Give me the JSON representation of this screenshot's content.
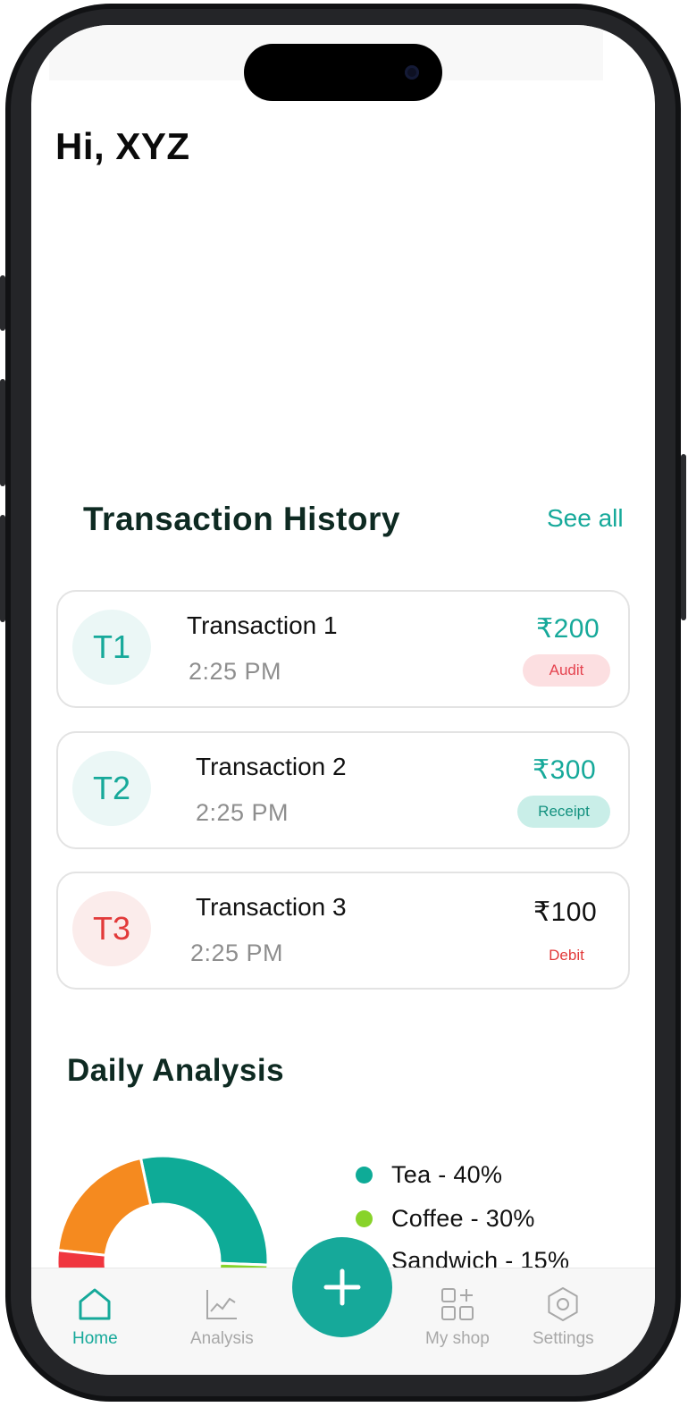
{
  "header": {
    "greeting": "Hi, XYZ"
  },
  "transactions_section": {
    "title": "Transaction History",
    "see_all_label": "See all",
    "items": [
      {
        "initials": "T1",
        "name": "Transaction 1",
        "time": "2:25 PM",
        "amount": "₹200",
        "tag": "Audit",
        "accent": "#16a99a",
        "tag_color": "#e5434f"
      },
      {
        "initials": "T2",
        "name": "Transaction 2",
        "time": "2:25 PM",
        "amount": "₹300",
        "tag": "Receipt",
        "accent": "#16a99a",
        "tag_color": "#13917f"
      },
      {
        "initials": "T3",
        "name": "Transaction 3",
        "time": "2:25 PM",
        "amount": "₹100",
        "tag": "Debit",
        "accent": "#e23a3a",
        "tag_color": "#e23a3a"
      }
    ]
  },
  "analysis_section": {
    "title": "Daily Analysis",
    "legend": [
      {
        "label": "Tea - 40%",
        "color": "#0eab97"
      },
      {
        "label": "Coffee - 30%",
        "color": "#88d32a"
      },
      {
        "label": "Sandwich - 15%",
        "color": "#f58a1f"
      }
    ],
    "slice_colors": [
      "#0eab97",
      "#88d32a",
      "#f58a1f",
      "#f0363f"
    ]
  },
  "bottom_nav": {
    "items": [
      {
        "label": "Home",
        "icon": "home-icon",
        "active": true
      },
      {
        "label": "Analysis",
        "icon": "analysis-icon",
        "active": false
      },
      {
        "label": "My shop",
        "icon": "shop-icon",
        "active": false
      },
      {
        "label": "Settings",
        "icon": "settings-icon",
        "active": false
      }
    ],
    "fab_icon": "plus-icon",
    "active_color": "#16a99a",
    "inactive_color": "#a8a8a8"
  }
}
